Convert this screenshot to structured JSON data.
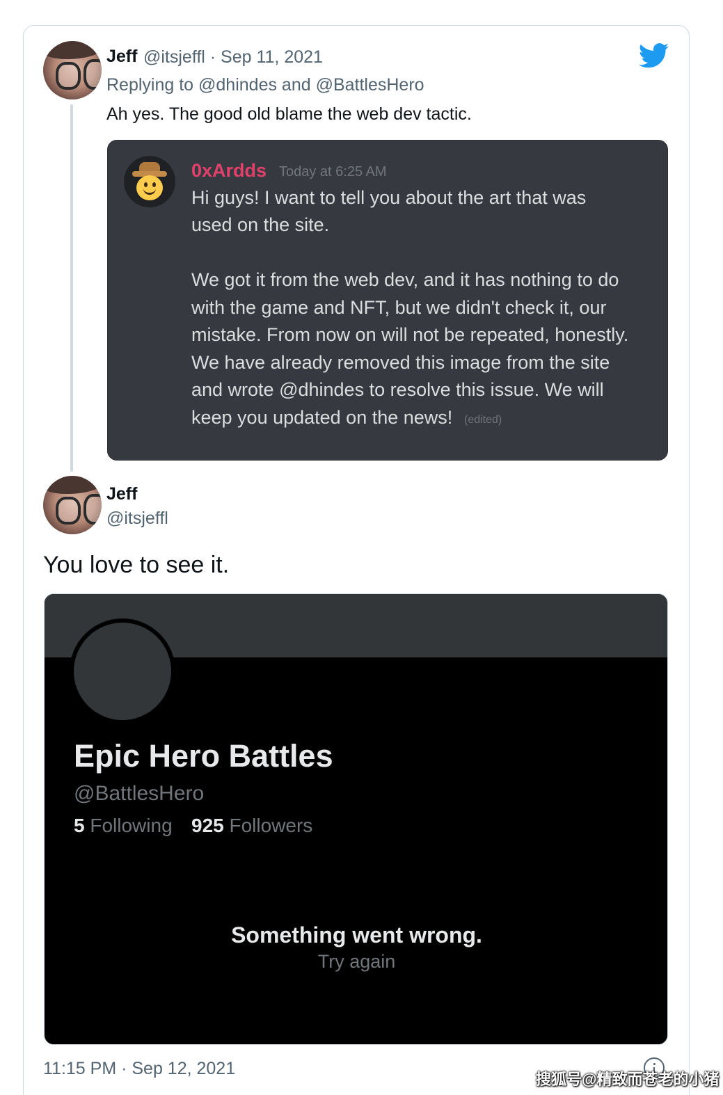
{
  "tweet1": {
    "name": "Jeff",
    "handle_date": "@itsjeffl · Sep 11, 2021",
    "replying_to": "Replying to @dhindes and @BattlesHero",
    "text": "Ah yes. The good old blame the web dev tactic."
  },
  "discord": {
    "username": "0xArdds",
    "timestamp": "Today at 6:25 AM",
    "lines": [
      "Hi guys! I want to tell you about the art that was",
      "used on the site.",
      "We got it from the web dev, and it has nothing to do",
      "with the game and NFT, but we didn't check it, our",
      "mistake. From now on will not be repeated, honestly.",
      "We have already removed this image from the site",
      "and wrote @dhindes to resolve this issue. We will",
      "keep you updated on the news!"
    ],
    "edited": "(edited)"
  },
  "tweet2": {
    "name": "Jeff",
    "handle": "@itsjeffl",
    "text": "You love to see it.",
    "timestamp": "11:15 PM · Sep 12, 2021"
  },
  "embedded_profile": {
    "name": "Epic Hero Battles",
    "handle": "@BattlesHero",
    "following_count": "5",
    "following_label": "Following",
    "followers_count": "925",
    "followers_label": "Followers",
    "error_title": "Something went wrong.",
    "error_action": "Try again"
  },
  "watermark": "搜狐号@精致而苍老的小猪",
  "colors": {
    "twitter_blue": "#1d9bf0",
    "discord_bg": "#36393f",
    "discord_username": "#e0426b"
  },
  "icons": [
    "twitter-bird-icon",
    "info-icon"
  ]
}
